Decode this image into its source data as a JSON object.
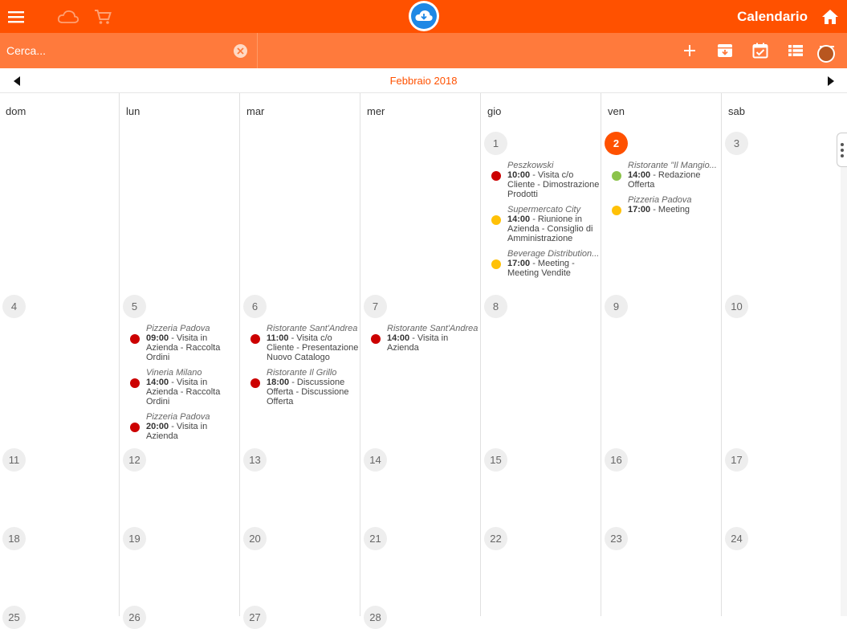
{
  "header": {
    "title": "Calendario",
    "icons": {
      "menu": "hamburger-menu-icon",
      "cloud": "cloud-icon",
      "cart": "shopping-cart-icon",
      "logo": "cloud-logo-icon",
      "home": "home-icon"
    }
  },
  "search": {
    "placeholder": "Cerca...",
    "value": ""
  },
  "toolbar": {
    "icons": [
      "add-icon",
      "archive-icon",
      "calendar-check-icon",
      "list-view-icon",
      "filter-icon"
    ]
  },
  "calendar": {
    "month_label": "Febbraio 2018",
    "day_names": [
      "dom",
      "lun",
      "mar",
      "mer",
      "gio",
      "ven",
      "sab"
    ],
    "weeks": [
      [
        null,
        null,
        null,
        null,
        "1",
        "2",
        "3"
      ],
      [
        "4",
        "5",
        "6",
        "7",
        "8",
        "9",
        "10"
      ],
      [
        "11",
        "12",
        "13",
        "14",
        "15",
        "16",
        "17"
      ],
      [
        "18",
        "19",
        "20",
        "21",
        "22",
        "23",
        "24"
      ],
      [
        "25",
        "26",
        "27",
        "28",
        null,
        null,
        null
      ]
    ],
    "today": "2",
    "events": {
      "d1": [
        {
          "client": "Peszkowski",
          "time": "10:00",
          "desc": " - Visita c/o Cliente - Dimostrazione Prodotti",
          "color": "#cc0000"
        },
        {
          "client": "Supermercato City",
          "time": "14:00",
          "desc": " - Riunione in Azienda - Consiglio di Amministrazione",
          "color": "#ffc107"
        },
        {
          "client": "Beverage Distribution...",
          "time": "17:00",
          "desc": " - Meeting - Meeting Vendite",
          "color": "#ffc107"
        }
      ],
      "d2": [
        {
          "client": "Ristorante \"Il Mangio...",
          "time": "14:00",
          "desc": " - Redazione Offerta",
          "color": "#8bc34a"
        },
        {
          "client": "Pizzeria Padova",
          "time": "17:00",
          "desc": " - Meeting",
          "color": "#ffc107"
        }
      ],
      "d5": [
        {
          "client": "Pizzeria Padova",
          "time": "09:00",
          "desc": " - Visita in Azienda - Raccolta Ordini",
          "color": "#cc0000"
        },
        {
          "client": "Vineria Milano",
          "time": "14:00",
          "desc": " - Visita in Azienda - Raccolta Ordini",
          "color": "#cc0000"
        },
        {
          "client": "Pizzeria Padova",
          "time": "20:00",
          "desc": " - Visita in Azienda",
          "color": "#cc0000"
        }
      ],
      "d6": [
        {
          "client": "Ristorante Sant'Andrea",
          "time": "11:00",
          "desc": " - Visita c/o Cliente - Presentazione Nuovo Catalogo",
          "color": "#cc0000"
        },
        {
          "client": "Ristorante Il Grillo",
          "time": "18:00",
          "desc": " - Discussione Offerta - Discussione Offerta",
          "color": "#cc0000"
        }
      ],
      "d7": [
        {
          "client": "Ristorante Sant'Andrea",
          "time": "14:00",
          "desc": " - Visita in Azienda",
          "color": "#cc0000"
        }
      ]
    }
  },
  "colors": {
    "primary": "#ff5100",
    "subbar": "#ff7a3c",
    "red_event": "#cc0000",
    "yellow_event": "#ffc107",
    "green_event": "#8bc34a"
  }
}
